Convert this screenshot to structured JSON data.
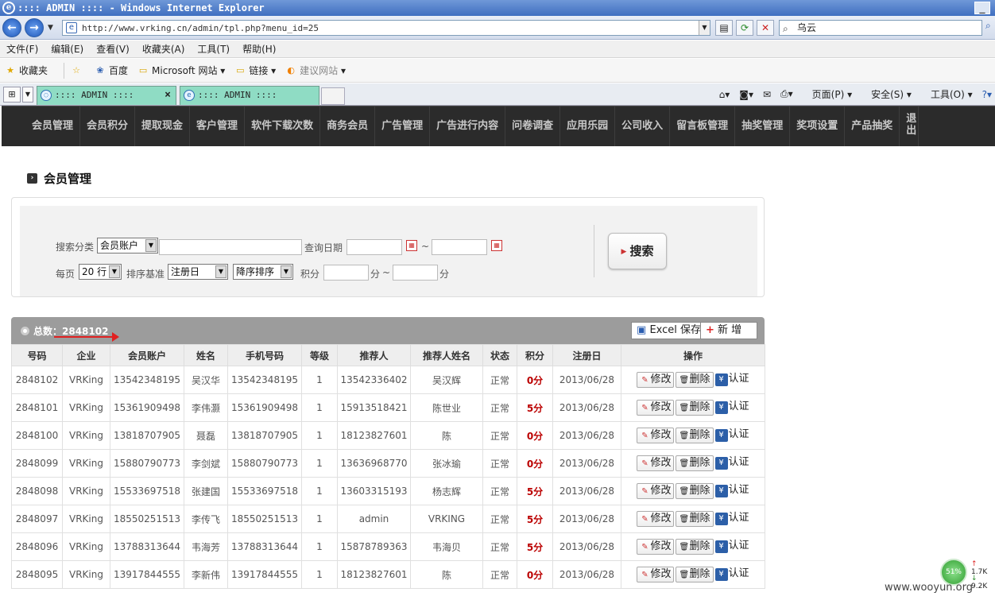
{
  "window": {
    "title": ":::: ADMIN :::: - Windows Internet Explorer",
    "min": "_"
  },
  "address": {
    "url": "http://www.vrking.cn/admin/tpl.php?menu_id=25",
    "search_value": "乌云"
  },
  "menubar": [
    "文件(F)",
    "编辑(E)",
    "查看(V)",
    "收藏夹(A)",
    "工具(T)",
    "帮助(H)"
  ],
  "favbar": {
    "favorites": "收藏夹",
    "baidu": "百度",
    "microsoft": "Microsoft 网站",
    "links": "链接",
    "suggest": "建议网站"
  },
  "tabs": [
    {
      "title": ":::: ADMIN ::::"
    },
    {
      "title": ":::: ADMIN ::::"
    }
  ],
  "cmdbar": {
    "page": "页面(P)",
    "safety": "安全(S)",
    "tools": "工具(O)"
  },
  "nav": [
    "会员管理",
    "会员积分",
    "提取现金",
    "客户管理",
    "软件下载次数",
    "商务会员",
    "广告管理",
    "广告进行内容",
    "问卷调查",
    "应用乐园",
    "公司收入",
    "留言板管理",
    "抽奖管理",
    "奖项设置",
    "产品抽奖",
    "退出"
  ],
  "page_title": "会员管理",
  "search": {
    "category_label": "搜索分类",
    "category_value": "会员账户",
    "date_label": "查询日期",
    "tilde": "~",
    "perpage_label": "每页",
    "perpage_value": "20 行",
    "sort_label": "排序基准",
    "sort_value": "注册日",
    "order_value": "降序排序",
    "points_label": "积分",
    "points_unit": "分",
    "button": "搜索"
  },
  "list": {
    "total": "总数：2848102",
    "excel": "Excel 保存",
    "add": "新 增"
  },
  "columns": [
    "号码",
    "企业",
    "会员账户",
    "姓名",
    "手机号码",
    "等级",
    "推荐人",
    "推荐人姓名",
    "状态",
    "积分",
    "注册日",
    "操作"
  ],
  "actions": {
    "edit": "修改",
    "delete": "删除",
    "auth": "认证"
  },
  "rows": [
    [
      "2848102",
      "VRKing",
      "13542348195",
      "吴汉华",
      "13542348195",
      "1",
      "13542336402",
      "吴汉辉",
      "正常",
      "0分",
      "2013/06/28"
    ],
    [
      "2848101",
      "VRKing",
      "15361909498",
      "李伟灏",
      "15361909498",
      "1",
      "15913518421",
      "陈世业",
      "正常",
      "5分",
      "2013/06/28"
    ],
    [
      "2848100",
      "VRKing",
      "13818707905",
      "聂磊",
      "13818707905",
      "1",
      "18123827601",
      "陈",
      "正常",
      "0分",
      "2013/06/28"
    ],
    [
      "2848099",
      "VRKing",
      "15880790773",
      "李剑斌",
      "15880790773",
      "1",
      "13636968770",
      "张冰瑜",
      "正常",
      "0分",
      "2013/06/28"
    ],
    [
      "2848098",
      "VRKing",
      "15533697518",
      "张建国",
      "15533697518",
      "1",
      "13603315193",
      "杨志辉",
      "正常",
      "5分",
      "2013/06/28"
    ],
    [
      "2848097",
      "VRKing",
      "18550251513",
      "李传飞",
      "18550251513",
      "1",
      "admin",
      "VRKING",
      "正常",
      "5分",
      "2013/06/28"
    ],
    [
      "2848096",
      "VRKing",
      "13788313644",
      "韦海芳",
      "13788313644",
      "1",
      "15878789363",
      "韦海贝",
      "正常",
      "5分",
      "2013/06/28"
    ],
    [
      "2848095",
      "VRKing",
      "13917844555",
      "李新伟",
      "13917844555",
      "1",
      "18123827601",
      "陈",
      "正常",
      "0分",
      "2013/06/28"
    ]
  ],
  "network": {
    "percent": "51%",
    "up": "1.7K",
    "down": "9.2K"
  },
  "watermark": "www.wooyun.org",
  "colors": {
    "nav_bg": "#2b2b2b",
    "tab_bg": "#8fdcc4",
    "points": "#bb0000",
    "list_header": "#9c9c9c"
  }
}
